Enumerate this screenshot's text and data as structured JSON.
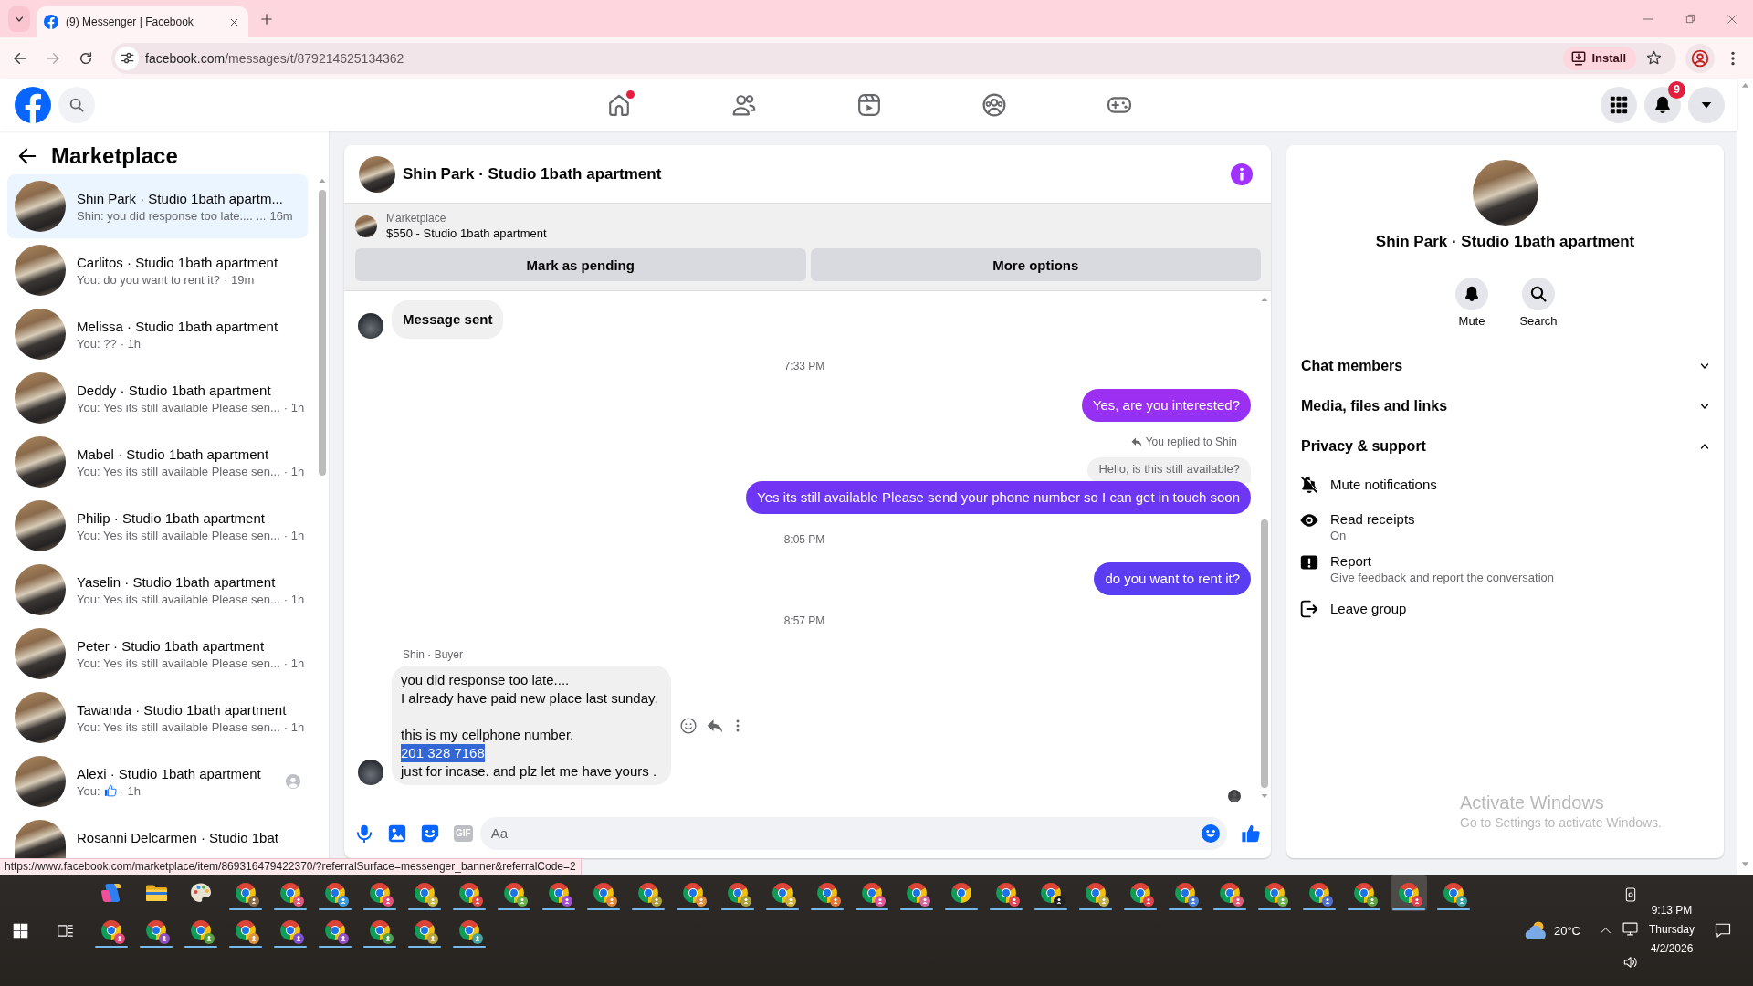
{
  "browser": {
    "tab_title": "(9) Messenger | Facebook",
    "url_host": "facebook.com",
    "url_path": "/messages/t/879214625134362",
    "forward_enabled": false,
    "install_label": "Install"
  },
  "top_nav": {
    "items": [
      {
        "kind": "home",
        "dot": true
      },
      {
        "kind": "friends",
        "dot": false
      },
      {
        "kind": "video",
        "dot": false
      },
      {
        "kind": "groups",
        "dot": false
      },
      {
        "kind": "gaming",
        "dot": false
      }
    ],
    "notification_count": "9"
  },
  "sidebar": {
    "title": "Marketplace",
    "conversations": [
      {
        "kind": "text",
        "title": "Shin Park · Studio 1bath apartm...",
        "preview": "Shin: you did response too late.... ...",
        "time": "16m",
        "seen": false,
        "selected": true
      },
      {
        "kind": "text",
        "title": "Carlitos · Studio 1bath apartment",
        "preview": "You: do you want to rent it?",
        "time": "· 19m",
        "seen": false,
        "selected": false
      },
      {
        "kind": "text",
        "title": "Melissa · Studio 1bath apartment",
        "preview": "You: ??",
        "time": "· 1h",
        "seen": false,
        "selected": false
      },
      {
        "kind": "text",
        "title": "Deddy · Studio 1bath apartment",
        "preview": "You: Yes its still available Please sen...",
        "time": "· 1h",
        "seen": false,
        "selected": false
      },
      {
        "kind": "text",
        "title": "Mabel · Studio 1bath apartment",
        "preview": "You: Yes its still available Please sen...",
        "time": "· 1h",
        "seen": false,
        "selected": false
      },
      {
        "kind": "text",
        "title": "Philip · Studio 1bath apartment",
        "preview": "You: Yes its still available Please sen...",
        "time": "· 1h",
        "seen": false,
        "selected": false
      },
      {
        "kind": "text",
        "title": "Yaselin · Studio 1bath apartment",
        "preview": "You: Yes its still available Please sen...",
        "time": "· 1h",
        "seen": false,
        "selected": false
      },
      {
        "kind": "text",
        "title": "Peter · Studio 1bath apartment",
        "preview": "You: Yes its still available Please sen...",
        "time": "· 1h",
        "seen": false,
        "selected": false
      },
      {
        "kind": "text",
        "title": "Tawanda · Studio 1bath apartment",
        "preview": "You: Yes its still available Please sen...",
        "time": "· 1h",
        "seen": false,
        "selected": false
      },
      {
        "kind": "like",
        "title": "Alexi · Studio 1bath apartment",
        "preview": "You:",
        "time": "· 1h",
        "seen": true,
        "selected": false
      },
      {
        "kind": "text",
        "title": "Rosanni Delcarmen · Studio 1bat",
        "seen": false,
        "selected": false
      }
    ]
  },
  "chat": {
    "title": "Shin Park · Studio 1bath apartment",
    "listing": {
      "source": "Marketplace",
      "summary": "$550 - Studio 1bath apartment",
      "actions": [
        "Mark as pending",
        "More options"
      ]
    },
    "messages": [
      {
        "kind": "notice",
        "text": "Message sent"
      },
      {
        "kind": "time",
        "text": "7:33 PM"
      },
      {
        "kind": "outgoing",
        "text": "Yes, are you interested?"
      },
      {
        "kind": "outgoing",
        "reply_note": "You replied to Shin",
        "quoted": "Hello, is this still available?",
        "text": "Yes its still available Please send your phone number so I can get in touch soon"
      },
      {
        "kind": "time",
        "text": "8:05 PM"
      },
      {
        "kind": "outgoing",
        "text": "do you want to rent it?"
      },
      {
        "kind": "time",
        "text": "8:57 PM"
      },
      {
        "kind": "incoming",
        "sender": "Shin · Buyer",
        "show_actions": true,
        "paragraphs": [
          [
            {
              "text": "you did response too late....",
              "highlighted": false
            },
            {
              "text": "I already have paid new place last sunday.",
              "highlighted": false
            }
          ],
          [
            {
              "text": "this is my cellphone number.",
              "highlighted": false
            },
            {
              "text": "201 328 7168",
              "highlighted": true
            },
            {
              "text": "just for incase. and plz let me have yours .",
              "highlighted": false
            }
          ]
        ]
      }
    ],
    "seen": true,
    "composer": {
      "gif_label": "GIF",
      "placeholder": "Aa"
    }
  },
  "details": {
    "name": "Shin Park · Studio 1bath apartment",
    "actions": [
      {
        "kind": "mute",
        "label": "Mute"
      },
      {
        "kind": "search",
        "label": "Search"
      }
    ],
    "sections": [
      {
        "title": "Chat members",
        "expanded": false
      },
      {
        "title": "Media, files and links",
        "expanded": false
      },
      {
        "title": "Privacy & support",
        "expanded": true,
        "items": [
          {
            "kind": "mute",
            "label": "Mute notifications"
          },
          {
            "kind": "eye",
            "label": "Read receipts",
            "detail": "On"
          },
          {
            "kind": "report",
            "label": "Report",
            "detail": "Give feedback and report the conversation"
          },
          {
            "kind": "leave",
            "label": "Leave group"
          }
        ]
      }
    ]
  },
  "status_url": "https://www.facebook.com/marketplace/item/869316479422370/?referralSurface=messenger_banner&referralCode=2",
  "activation_notice": {
    "title": "Activate Windows",
    "detail": "Go to Settings to activate Windows."
  },
  "taskbar": {
    "apps": [
      {
        "kind": "copilot",
        "running": false,
        "selected": false
      },
      {
        "kind": "folder",
        "running": false,
        "selected": false
      },
      {
        "kind": "palette",
        "running": false,
        "selected": false
      },
      {
        "kind": "browser",
        "color": "#8a6a4a",
        "running": true,
        "selected": false
      },
      {
        "kind": "browser",
        "color": "#e0587a",
        "running": true,
        "selected": false
      },
      {
        "kind": "browser",
        "color": "#3a9ad9",
        "running": true,
        "selected": false
      },
      {
        "kind": "browser",
        "color": "#e0507a",
        "running": true,
        "selected": false
      },
      {
        "kind": "browser",
        "color": "#c8b84a",
        "running": true,
        "selected": false
      },
      {
        "kind": "browser",
        "color": "#e04a4a",
        "running": true,
        "selected": false
      },
      {
        "kind": "browser",
        "color": "#6ab04a",
        "running": true,
        "selected": false
      },
      {
        "kind": "browser",
        "color": "#a050d0",
        "running": true,
        "selected": false
      },
      {
        "kind": "browser",
        "color": "#e08a3a",
        "running": true,
        "selected": false
      },
      {
        "kind": "browser",
        "color": "#b0a040",
        "running": true,
        "selected": false
      },
      {
        "kind": "browser",
        "color": "#e09040",
        "running": true,
        "selected": false
      },
      {
        "kind": "browser",
        "color": "#a8a040",
        "running": true,
        "selected": false
      },
      {
        "kind": "browser",
        "color": "#d0b040",
        "running": true,
        "selected": false
      },
      {
        "kind": "browser",
        "color": "#e07a3a",
        "running": true,
        "selected": false
      },
      {
        "kind": "browser",
        "color": "#e05a9a",
        "running": true,
        "selected": false
      },
      {
        "kind": "browser",
        "color": "#d06aa0",
        "running": true,
        "selected": false
      },
      {
        "kind": "browser",
        "running": true,
        "selected": false
      },
      {
        "kind": "browser",
        "color": "#e04a5a",
        "running": true,
        "selected": false
      },
      {
        "kind": "browser",
        "color": "#202020",
        "running": true,
        "selected": false
      },
      {
        "kind": "browser",
        "color": "#c0b050",
        "running": true,
        "selected": false
      },
      {
        "kind": "browser",
        "color": "#e04050",
        "running": true,
        "selected": false
      },
      {
        "kind": "browser",
        "color": "#4a80d0",
        "running": true,
        "selected": false
      },
      {
        "kind": "browser",
        "color": "#e05a7a",
        "running": true,
        "selected": false
      },
      {
        "kind": "browser",
        "color": "#70b050",
        "running": true,
        "selected": false
      },
      {
        "kind": "browser",
        "color": "#5070d0",
        "running": true,
        "selected": false
      },
      {
        "kind": "browser",
        "color": "#60a040",
        "running": true,
        "selected": false
      },
      {
        "kind": "browser",
        "color": "#e04450",
        "running": true,
        "selected": true
      },
      {
        "kind": "browser",
        "color": "#40a0a0",
        "running": true,
        "selected": false
      },
      {
        "kind": "browser",
        "color": "#e04a7a",
        "running": true,
        "selected": false
      },
      {
        "kind": "browser",
        "color": "#9050c0",
        "running": true,
        "selected": false
      },
      {
        "kind": "browser",
        "color": "#5aa040",
        "running": true,
        "selected": false
      },
      {
        "kind": "browser",
        "color": "#e09440",
        "running": true,
        "selected": false
      },
      {
        "kind": "browser",
        "color": "#8050d0",
        "running": true,
        "selected": false
      },
      {
        "kind": "browser",
        "color": "#9450c4",
        "running": true,
        "selected": false
      },
      {
        "kind": "browser",
        "color": "#50a050",
        "running": true,
        "selected": false
      },
      {
        "kind": "browser",
        "color": "#b4a444",
        "running": true,
        "selected": false
      },
      {
        "kind": "browser",
        "color": "#44a4a0",
        "running": true,
        "selected": false
      }
    ],
    "weather": "20°C",
    "clock": {
      "time": "9:13 PM",
      "day": "Thursday",
      "date": "4/2/2026"
    }
  }
}
